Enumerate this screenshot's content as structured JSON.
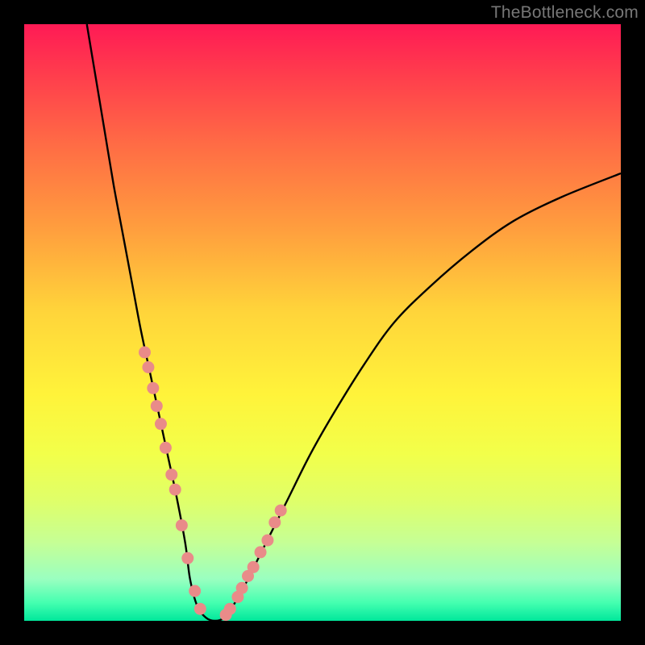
{
  "watermark": "TheBottleneck.com",
  "colors": {
    "frame": "#000000",
    "gradient_top": "#ff1a55",
    "gradient_bottom": "#00e79b",
    "curve": "#000000",
    "marker": "#e98b89"
  },
  "chart_data": {
    "type": "line",
    "title": "",
    "xlabel": "",
    "ylabel": "",
    "xlim": [
      0,
      100
    ],
    "ylim": [
      0,
      100
    ],
    "curve": {
      "x": [
        10.5,
        12,
        13.5,
        15,
        16.5,
        18,
        19.5,
        21,
        22.5,
        24,
        25.5,
        27,
        27.8,
        29,
        30.5,
        32,
        33.5,
        35,
        37,
        40,
        44,
        48,
        52,
        57,
        62,
        68,
        75,
        82,
        90,
        100
      ],
      "y": [
        100,
        91,
        82,
        73,
        65,
        57,
        49,
        42,
        35,
        28,
        21,
        13,
        7,
        2.5,
        0.5,
        0,
        0.5,
        2.5,
        6,
        12,
        20,
        28,
        35,
        43,
        50,
        56,
        62,
        67,
        71,
        75
      ]
    },
    "markers_left": {
      "x": [
        20.2,
        20.8,
        21.6,
        22.2,
        22.9,
        23.7,
        24.7,
        25.3,
        26.4,
        27.4,
        28.6,
        29.5
      ],
      "y": [
        45,
        42.5,
        39,
        36,
        33,
        29,
        24.5,
        22,
        16,
        10.5,
        5,
        2
      ]
    },
    "markers_right": {
      "x": [
        33.8,
        34.5,
        35.8,
        36.5,
        37.5,
        38.4,
        39.6,
        40.8,
        42,
        43
      ],
      "y": [
        1,
        2,
        4,
        5.5,
        7.5,
        9,
        11.5,
        13.5,
        16.5,
        18.5
      ]
    }
  }
}
